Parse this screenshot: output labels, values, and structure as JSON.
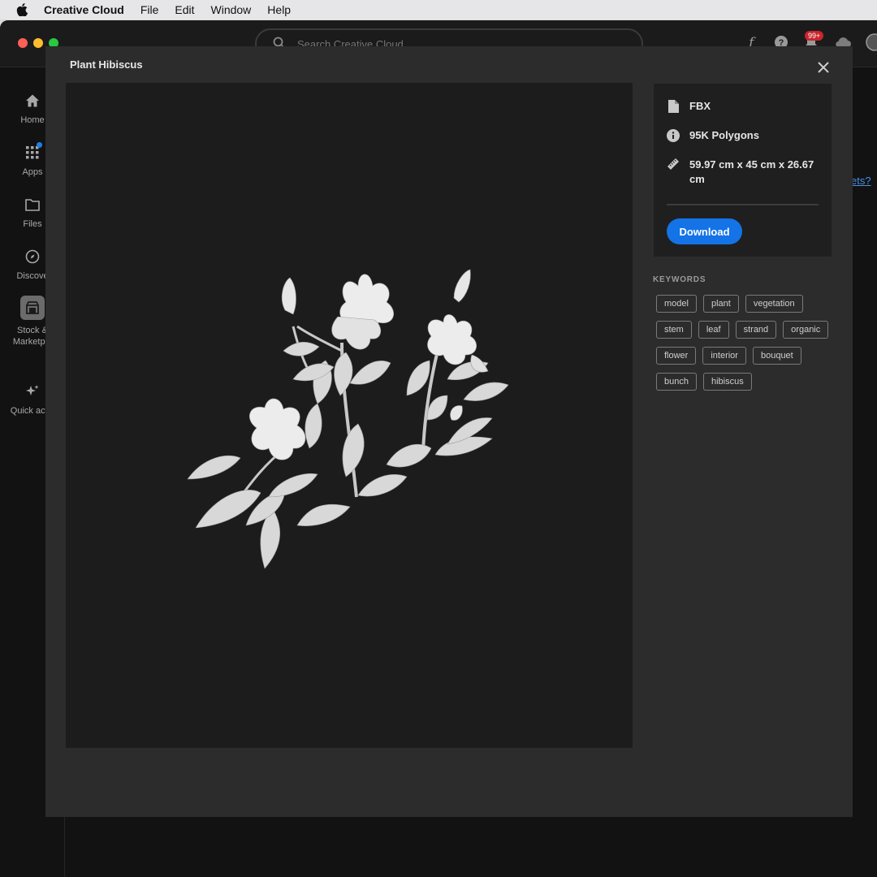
{
  "menubar": {
    "app_name": "Creative Cloud",
    "items": [
      "File",
      "Edit",
      "Window",
      "Help"
    ]
  },
  "titlebar": {
    "search_placeholder": "Search Creative Cloud",
    "notification_count": "99+"
  },
  "sidebar": {
    "items": [
      {
        "label": "Home",
        "icon": "home-icon"
      },
      {
        "label": "Apps",
        "icon": "apps-grid-icon"
      },
      {
        "label": "Files",
        "icon": "folder-icon"
      },
      {
        "label": "Discove",
        "icon": "compass-icon"
      },
      {
        "label": "Stock &\nMarketpla",
        "icon": "stock-icon"
      },
      {
        "label": "Quick actio",
        "icon": "sparkle-icon"
      }
    ]
  },
  "background": {
    "link_fragment": "ets?"
  },
  "modal": {
    "title": "Plant Hibiscus",
    "info": {
      "format": "FBX",
      "polygons": "95K Polygons",
      "dimensions": "59.97 cm x 45 cm x 26.67 cm"
    },
    "download_label": "Download",
    "keywords_heading": "KEYWORDS",
    "keyword_rows": [
      [
        "model",
        "plant",
        "vegetation"
      ],
      [
        "stem",
        "leaf",
        "strand",
        "organic"
      ],
      [
        "flower",
        "interior",
        "bouquet"
      ],
      [
        "bunch",
        "hibiscus"
      ]
    ]
  },
  "colors": {
    "accent": "#1473e6",
    "badge": "#c9252d"
  }
}
